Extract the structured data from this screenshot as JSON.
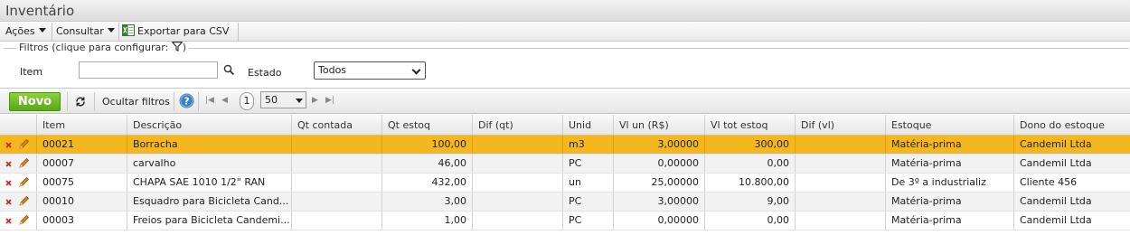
{
  "page": {
    "title": "Inventário"
  },
  "menubar": {
    "acoes": "Ações",
    "consultar": "Consultar",
    "exportar": "Exportar para CSV"
  },
  "filters": {
    "legend": "Filtros (clique para configurar:",
    "legend_end": ")",
    "item_label": "Item",
    "item_value": "",
    "estado_label": "Estado",
    "estado_value": "Todos"
  },
  "toolbar": {
    "novo": "Novo",
    "ocultar_filtros": "Ocultar filtros",
    "page": "1",
    "page_size": "50"
  },
  "table": {
    "columns": [
      "Item",
      "Descrição",
      "Qt contada",
      "Qt estoq",
      "Dif (qt)",
      "Unid",
      "Vl un (R$)",
      "Vl tot estoq",
      "Dif (vl)",
      "Estoque",
      "Dono do estoque"
    ],
    "rows": [
      {
        "item": "00021",
        "descricao": "Borracha",
        "qt_contada": "",
        "qt_estoq": "100,00",
        "dif_qt": "",
        "unid": "m3",
        "vl_un": "3,00000",
        "vl_tot": "300,00",
        "dif_vl": "",
        "estoque": "Matéria-prima",
        "dono": "Candemil Ltda"
      },
      {
        "item": "00007",
        "descricao": "carvalho",
        "qt_contada": "",
        "qt_estoq": "46,00",
        "dif_qt": "",
        "unid": "PC",
        "vl_un": "0,00000",
        "vl_tot": "0,00",
        "dif_vl": "",
        "estoque": "Matéria-prima",
        "dono": "Candemil Ltda"
      },
      {
        "item": "00075",
        "descricao": "CHAPA SAE 1010 1/2\" RAN",
        "qt_contada": "",
        "qt_estoq": "432,00",
        "dif_qt": "",
        "unid": "un",
        "vl_un": "25,00000",
        "vl_tot": "10.800,00",
        "dif_vl": "",
        "estoque": "De 3º a industrializ",
        "dono": "Cliente 456"
      },
      {
        "item": "00010",
        "descricao": "Esquadro para Bicicleta Cand...",
        "qt_contada": "",
        "qt_estoq": "3,00",
        "dif_qt": "",
        "unid": "PC",
        "vl_un": "3,00000",
        "vl_tot": "9,00",
        "dif_vl": "",
        "estoque": "Matéria-prima",
        "dono": "Candemil Ltda"
      },
      {
        "item": "00003",
        "descricao": "Freios para Bicicleta Candemi...",
        "qt_contada": "",
        "qt_estoq": "1,00",
        "dif_qt": "",
        "unid": "PC",
        "vl_un": "0,00000",
        "vl_tot": "0,00",
        "dif_vl": "",
        "estoque": "Matéria-prima",
        "dono": "Candemil Ltda"
      }
    ]
  },
  "colors": {
    "selected_row": "#f4b81e",
    "novo_button": "#5aa61a",
    "help_icon": "#3a7fc4",
    "delete_icon": "#cc2a2a",
    "edit_icon": "#e0891a"
  }
}
